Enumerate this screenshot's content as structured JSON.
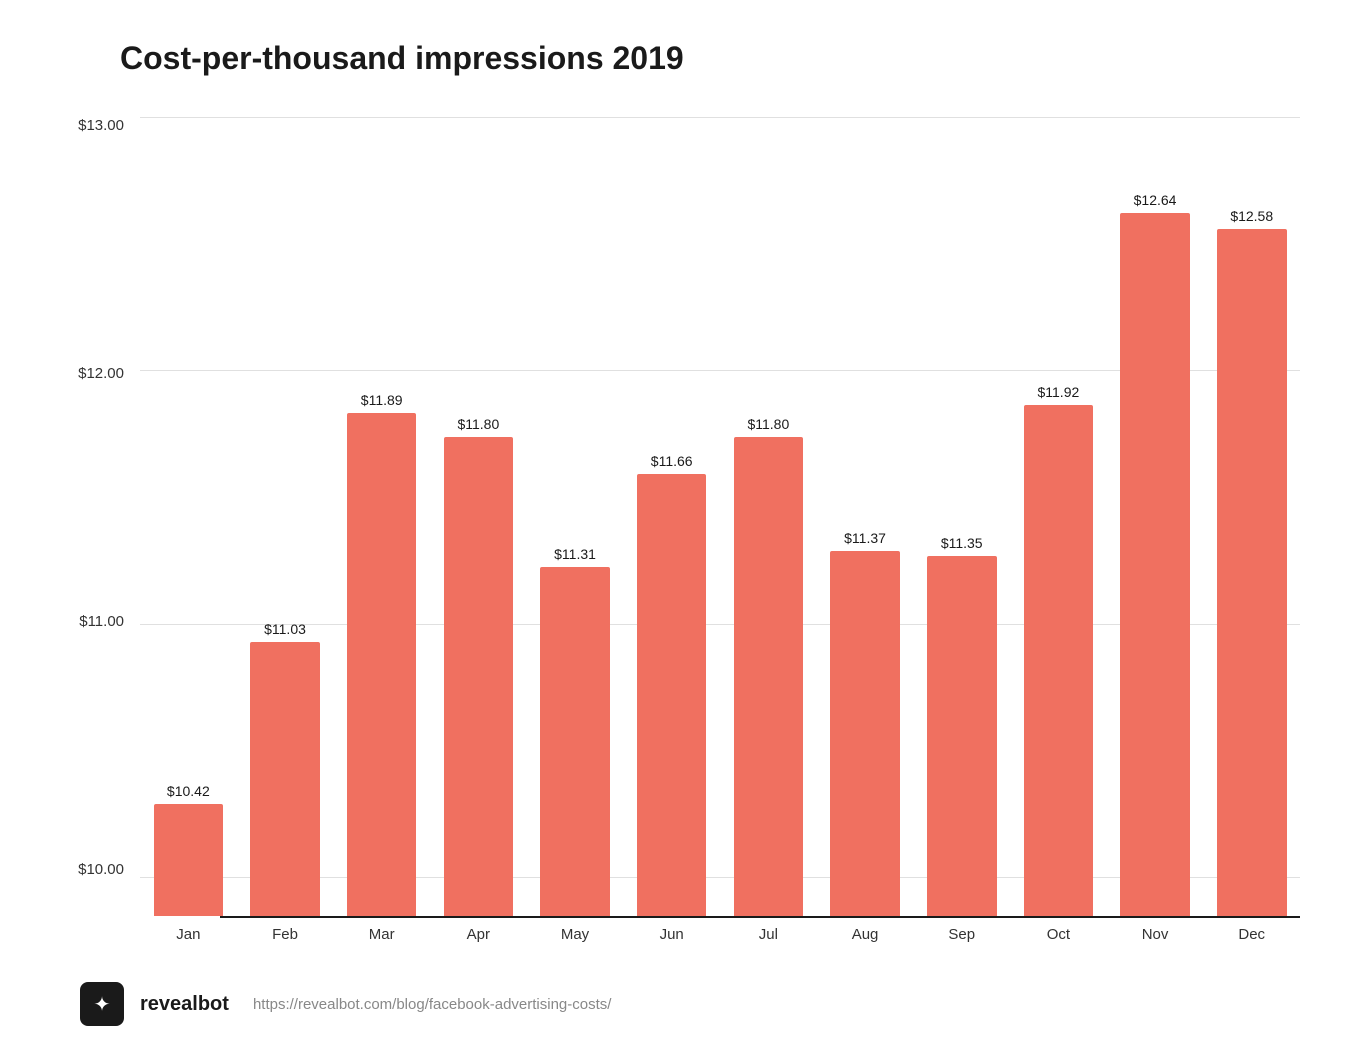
{
  "title": "Cost-per-thousand impressions 2019",
  "yAxis": {
    "labels": [
      "$13.00",
      "$12.00",
      "$11.00",
      "$10.00"
    ]
  },
  "bars": [
    {
      "month": "Jan",
      "value": 10.42,
      "label": "$10.42"
    },
    {
      "month": "Feb",
      "value": 11.03,
      "label": "$11.03"
    },
    {
      "month": "Mar",
      "value": 11.89,
      "label": "$11.89"
    },
    {
      "month": "Apr",
      "value": 11.8,
      "label": "$11.80"
    },
    {
      "month": "May",
      "value": 11.31,
      "label": "$11.31"
    },
    {
      "month": "Jun",
      "value": 11.66,
      "label": "$11.66"
    },
    {
      "month": "Jul",
      "value": 11.8,
      "label": "$11.80"
    },
    {
      "month": "Aug",
      "value": 11.37,
      "label": "$11.37"
    },
    {
      "month": "Sep",
      "value": 11.35,
      "label": "$11.35"
    },
    {
      "month": "Oct",
      "value": 11.92,
      "label": "$11.92"
    },
    {
      "month": "Nov",
      "value": 12.64,
      "label": "$12.64"
    },
    {
      "month": "Dec",
      "value": 12.58,
      "label": "$12.58"
    }
  ],
  "chartConfig": {
    "minValue": 10.0,
    "maxValue": 13.0,
    "barColor": "#f07060"
  },
  "footer": {
    "brandName": "revealbot",
    "url": "https://revealbot.com/blog/facebook-advertising-costs/"
  }
}
